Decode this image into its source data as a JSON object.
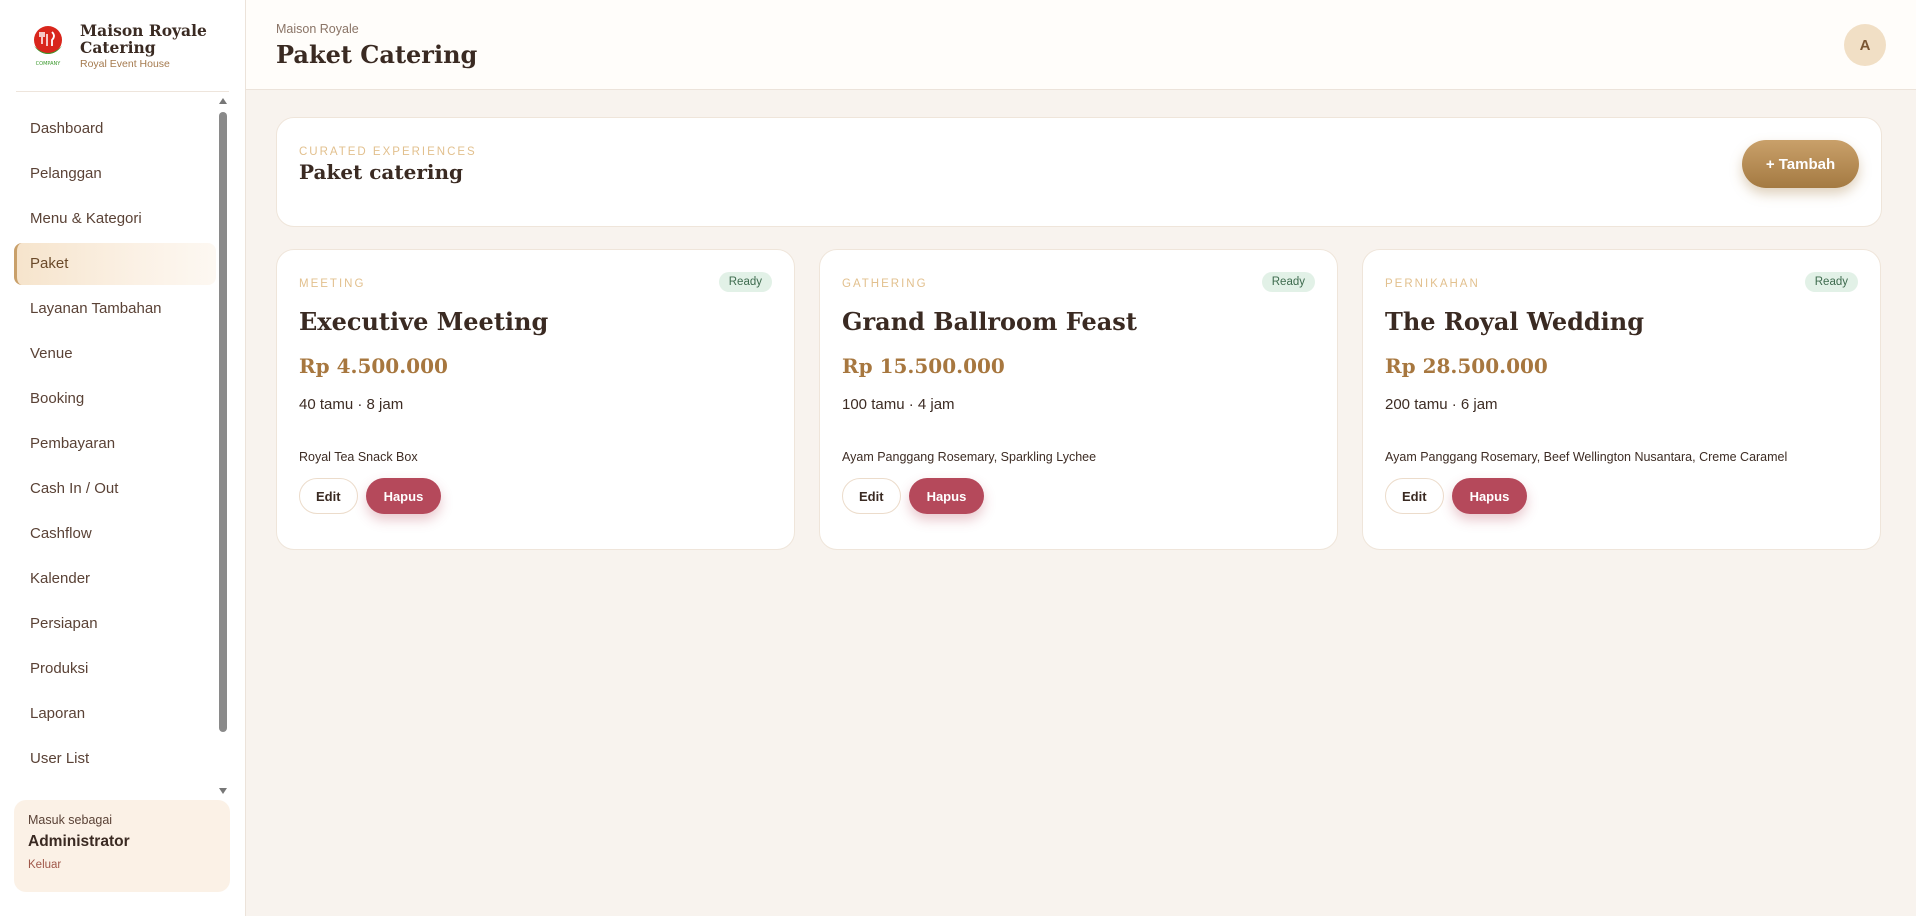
{
  "brand": {
    "name": "Maison Royale Catering",
    "subtitle": "Royal Event House",
    "logo_text": "COMPANY"
  },
  "sidebar": {
    "items": [
      {
        "label": "Dashboard",
        "active": false
      },
      {
        "label": "Pelanggan",
        "active": false
      },
      {
        "label": "Menu & Kategori",
        "active": false
      },
      {
        "label": "Paket",
        "active": true
      },
      {
        "label": "Layanan Tambahan",
        "active": false
      },
      {
        "label": "Venue",
        "active": false
      },
      {
        "label": "Booking",
        "active": false
      },
      {
        "label": "Pembayaran",
        "active": false
      },
      {
        "label": "Cash In / Out",
        "active": false
      },
      {
        "label": "Cashflow",
        "active": false
      },
      {
        "label": "Kalender",
        "active": false
      },
      {
        "label": "Persiapan",
        "active": false
      },
      {
        "label": "Produksi",
        "active": false
      },
      {
        "label": "Laporan",
        "active": false
      },
      {
        "label": "User List",
        "active": false
      }
    ]
  },
  "user": {
    "label": "Masuk sebagai",
    "role": "Administrator",
    "logout": "Keluar"
  },
  "topbar": {
    "breadcrumb": "Maison Royale",
    "title": "Paket Catering",
    "avatar_initial": "A"
  },
  "header": {
    "eyebrow": "CURATED EXPERIENCES",
    "title": "Paket catering",
    "add_label": "+ Tambah"
  },
  "packages": [
    {
      "category": "MEETING",
      "status": "Ready",
      "name": "Executive Meeting",
      "price": "Rp 4.500.000",
      "meta": "40 tamu · 8 jam",
      "items": "Royal Tea Snack Box",
      "edit_label": "Edit",
      "delete_label": "Hapus"
    },
    {
      "category": "GATHERING",
      "status": "Ready",
      "name": "Grand Ballroom Feast",
      "price": "Rp 15.500.000",
      "meta": "100 tamu · 4 jam",
      "items": "Ayam Panggang Rosemary, Sparkling Lychee",
      "edit_label": "Edit",
      "delete_label": "Hapus"
    },
    {
      "category": "PERNIKAHAN",
      "status": "Ready",
      "name": "The Royal Wedding",
      "price": "Rp 28.500.000",
      "meta": "200 tamu · 6 jam",
      "items": "Ayam Panggang Rosemary, Beef Wellington Nusantara, Creme Caramel",
      "edit_label": "Edit",
      "delete_label": "Hapus"
    }
  ],
  "colors": {
    "accent_gold": "#c9a06a",
    "price_gold": "#a7773f",
    "delete_red": "#b5495b",
    "ready_badge_bg": "#e2f1e7"
  }
}
